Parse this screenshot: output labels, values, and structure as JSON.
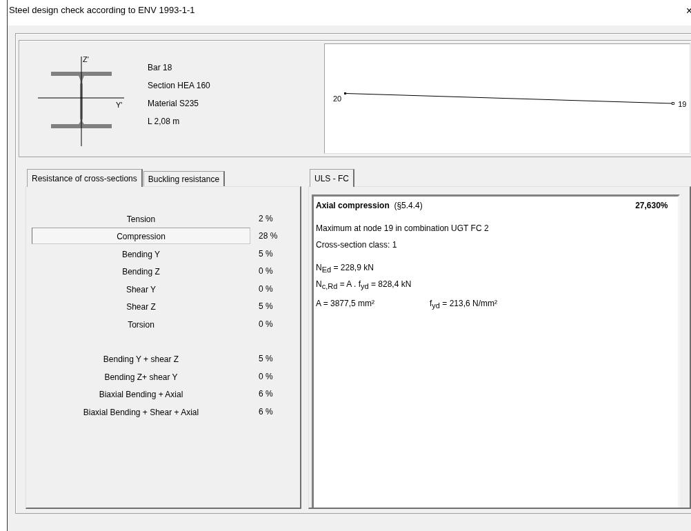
{
  "window": {
    "title": "Steel design check according to ENV 1993-1-1",
    "close": "×"
  },
  "section": {
    "axis_z": "Z'",
    "axis_y": "Y'",
    "info": [
      "Bar 18",
      "Section HEA 160",
      "Material S235",
      "L 2,08 m"
    ]
  },
  "member_diagram": {
    "start_node": "20",
    "end_node": "19"
  },
  "left_tabs": [
    {
      "label": "Resistance of cross-sections",
      "selected": true
    },
    {
      "label": "Buckling resistance",
      "selected": false
    }
  ],
  "checks": [
    [
      {
        "label": "Tension",
        "value": "2 %",
        "selected": false
      },
      {
        "label": "Compression",
        "value": "28 %",
        "selected": true
      },
      {
        "label": "Bending Y",
        "value": "5 %",
        "selected": false
      },
      {
        "label": "Bending Z",
        "value": "0 %",
        "selected": false
      },
      {
        "label": "Shear Y",
        "value": "0 %",
        "selected": false
      },
      {
        "label": "Shear Z",
        "value": "5 %",
        "selected": false
      },
      {
        "label": "Torsion",
        "value": "0 %",
        "selected": false
      }
    ],
    [
      {
        "label": "Bending Y + shear Z",
        "value": "5 %",
        "selected": false
      },
      {
        "label": "Bending Z+ shear Y",
        "value": "0 %",
        "selected": false
      },
      {
        "label": "Biaxial Bending + Axial",
        "value": "6 %",
        "selected": false
      },
      {
        "label": "Biaxial Bending + Shear + Axial",
        "value": "6 %",
        "selected": false
      }
    ]
  ],
  "right_tabs": [
    {
      "label": "ULS - FC",
      "selected": true
    }
  ],
  "detail": {
    "heading": "**Axial compression**  (§5.4.4)",
    "ratio": "27,630%",
    "lines": [
      "Maximum at node 19 in combination UGT FC 2",
      "Cross-section class: 1"
    ],
    "formulas": [
      "N$_{Ed}$ = 228,9 kN",
      "N$_{c,Rd}$ = A . f$_{yd}$ = 828,4 kN"
    ],
    "values": [
      "A = 3877,5 mm²",
      "f$_{yd}$ = 213,6 N/mm²"
    ]
  }
}
